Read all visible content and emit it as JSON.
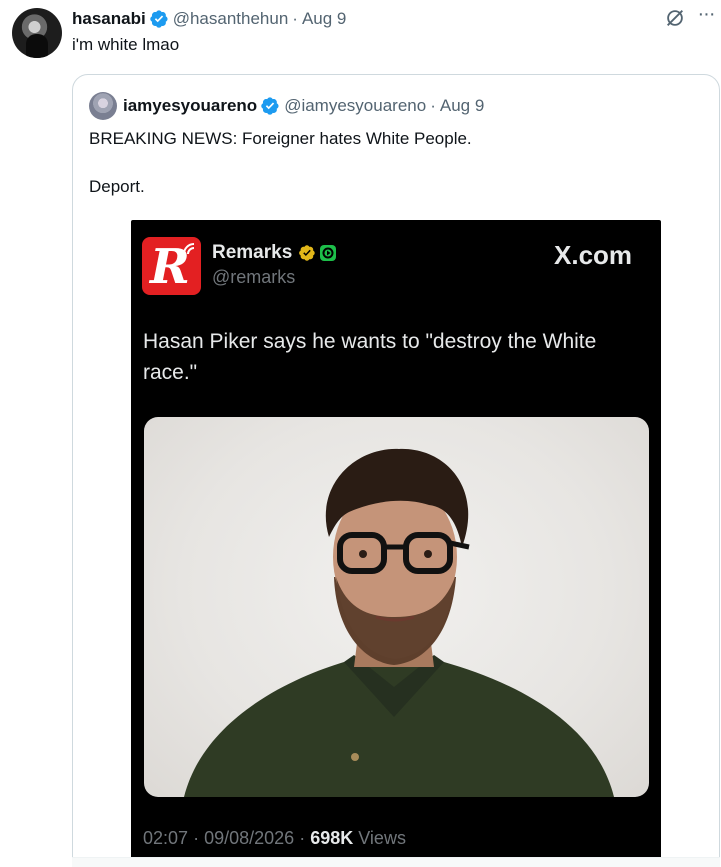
{
  "tweet": {
    "author_name": "hasanabi",
    "author_handle": "@hasanthehun",
    "separator": "·",
    "date": "Aug 9",
    "text": "i'm white lmao",
    "icons": {
      "grok": "grok-icon",
      "more": "more-icon",
      "verified": "verified-badge-icon"
    }
  },
  "quote": {
    "author_name": "iamyesyouareno",
    "author_handle": "@iamyesyouareno",
    "separator": "·",
    "date": "Aug 9",
    "text_line1": "BREAKING NEWS: Foreigner hates White People.",
    "text_line2": "Deport.",
    "embed": {
      "logo_letter": "R",
      "account_name": "Remarks",
      "account_handle": "@remarks",
      "site": "X.com",
      "text": "Hasan Piker says he wants to \"destroy the White race.\"",
      "footer_time": "02:07",
      "footer_sep": "·",
      "footer_date": "09/08/2026",
      "footer_sep2": "·",
      "views_count": "698K",
      "views_label": "Views"
    }
  },
  "colors": {
    "verified_blue": "#1d9bf0",
    "muted_text": "#536471",
    "border": "#cfd9de",
    "brand_red": "#e32022",
    "gold_badge": "#e2b719",
    "green_badge": "#1dbf4a"
  }
}
